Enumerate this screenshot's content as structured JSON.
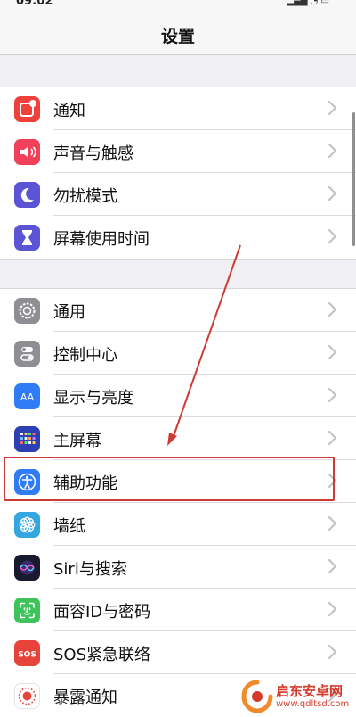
{
  "status_bar": {
    "time": "09:02",
    "signal": "▂▄▆ ◔ ▭"
  },
  "header": {
    "title": "设置"
  },
  "groups": [
    {
      "items": [
        {
          "label": "通知",
          "icon": "notifications-icon",
          "color": "#f0403b"
        },
        {
          "label": "声音与触感",
          "icon": "sound-icon",
          "color": "#f0405a"
        },
        {
          "label": "勿扰模式",
          "icon": "moon-icon",
          "color": "#5b55d6"
        },
        {
          "label": "屏幕使用时间",
          "icon": "hourglass-icon",
          "color": "#5b55d6"
        }
      ]
    },
    {
      "items": [
        {
          "label": "通用",
          "icon": "gear-icon",
          "color": "#8e8e93"
        },
        {
          "label": "控制中心",
          "icon": "toggles-icon",
          "color": "#8e8e93"
        },
        {
          "label": "显示与亮度",
          "icon": "display-aa-icon",
          "color": "#2f7cf6"
        },
        {
          "label": "主屏幕",
          "icon": "home-grid-icon",
          "color": "#2e3fb3"
        },
        {
          "label": "辅助功能",
          "icon": "accessibility-icon",
          "color": "#2f7cf6"
        },
        {
          "label": "墙纸",
          "icon": "flower-icon",
          "color": "#35a7e0"
        },
        {
          "label": "Siri与搜索",
          "icon": "siri-icon",
          "color": "#1a1a2e"
        },
        {
          "label": "面容ID与密码",
          "icon": "face-id-icon",
          "color": "#3cc45a"
        },
        {
          "label": "SOS紧急联络",
          "icon": "sos-icon",
          "color": "#e8433a"
        },
        {
          "label": "暴露通知",
          "icon": "exposure-icon",
          "color": "#ffffff"
        }
      ]
    }
  ],
  "annotation": {
    "highlight_color": "#cc3b35",
    "highlighted_item": "辅助功能"
  },
  "watermark": {
    "text": "启东安卓网",
    "url": "www.qdltsd.com",
    "color": "#d33b2c"
  }
}
